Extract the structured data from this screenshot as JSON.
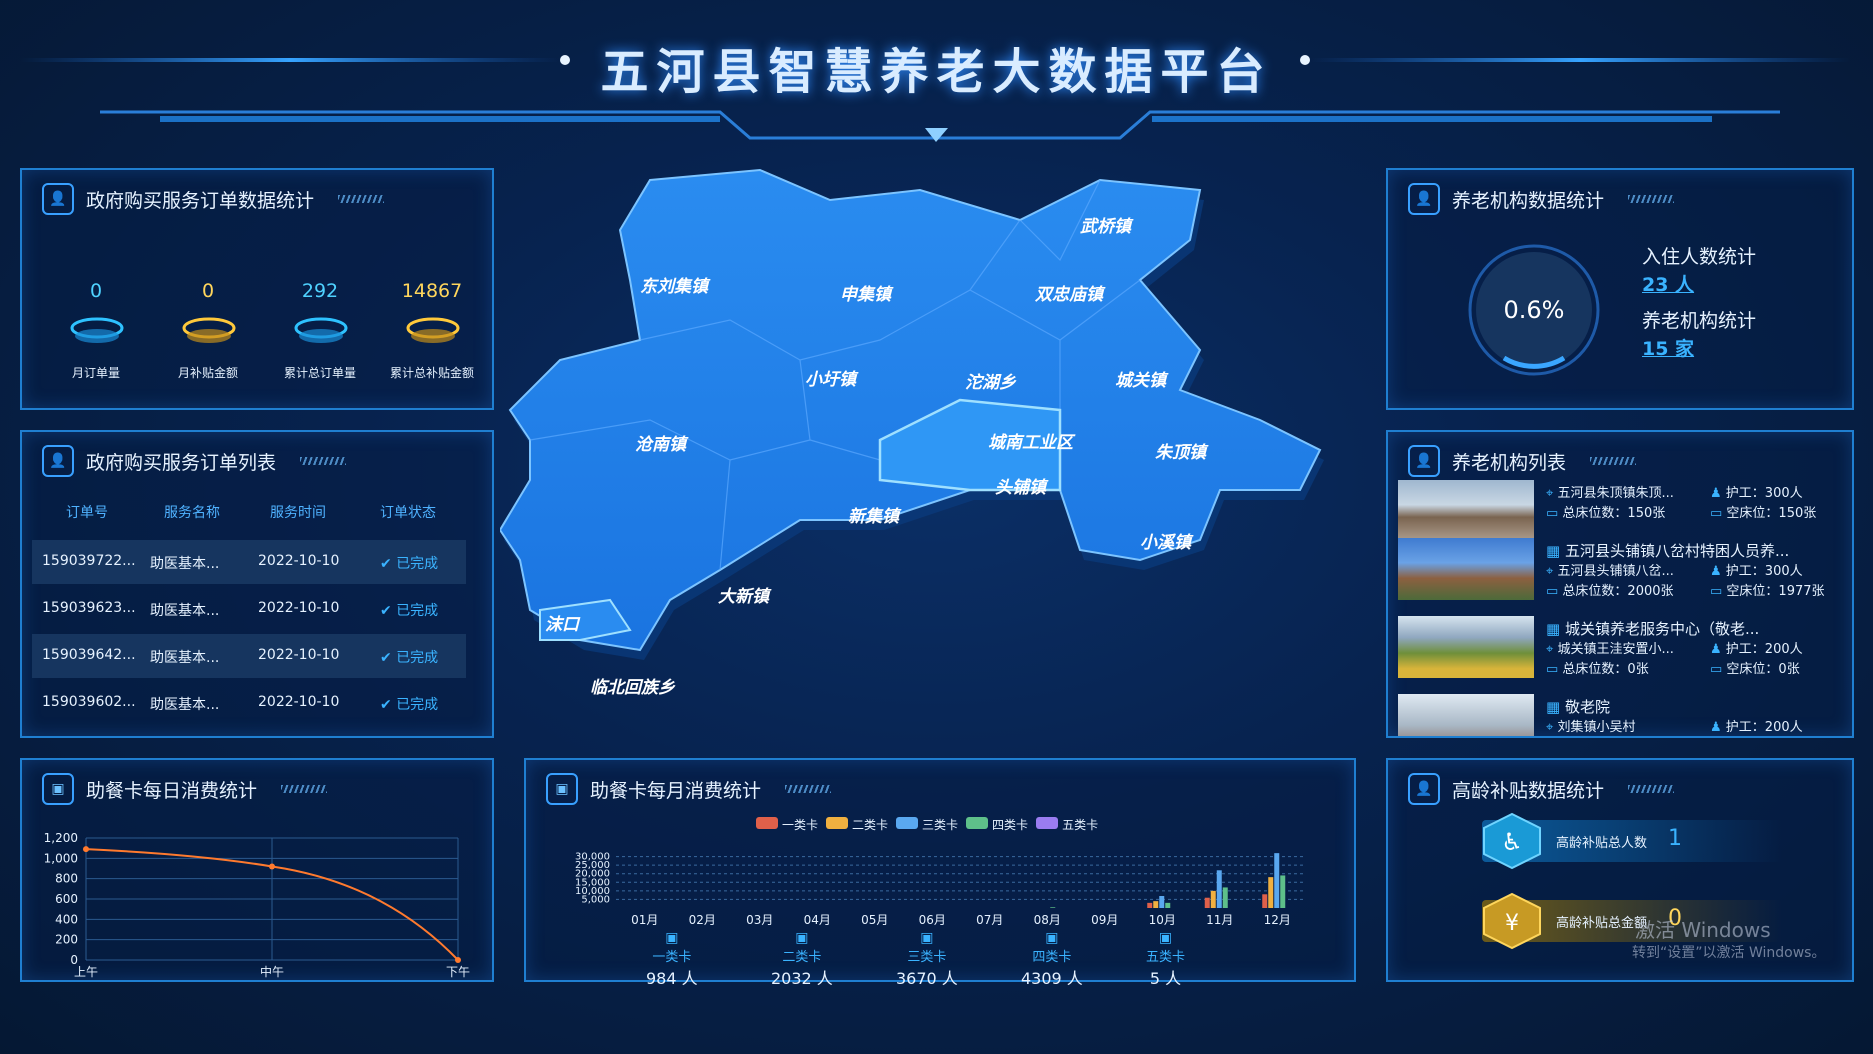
{
  "header": {
    "title": "五河县智慧养老大数据平台"
  },
  "order_stats": {
    "title": "政府购买服务订单数据统计",
    "items": [
      {
        "value": "0",
        "label": "月订单量",
        "color": "#4fd2ff"
      },
      {
        "value": "0",
        "label": "月补贴金额",
        "color": "#ffd65c"
      },
      {
        "value": "292",
        "label": "累计总订单量",
        "color": "#4fd2ff"
      },
      {
        "value": "14867",
        "label": "累计总补贴金额",
        "color": "#ffd65c"
      }
    ]
  },
  "order_list": {
    "title": "政府购买服务订单列表",
    "headers": [
      "订单号",
      "服务名称",
      "服务时间",
      "订单状态"
    ],
    "rows": [
      {
        "id": "159039722...",
        "name": "助医基本...",
        "time": "2022-10-10",
        "status": "已完成"
      },
      {
        "id": "159039623...",
        "name": "助医基本...",
        "time": "2022-10-10",
        "status": "已完成"
      },
      {
        "id": "159039642...",
        "name": "助医基本...",
        "time": "2022-10-10",
        "status": "已完成"
      },
      {
        "id": "159039602...",
        "name": "助医基本...",
        "time": "2022-10-10",
        "status": "已完成"
      }
    ]
  },
  "daily": {
    "title": "助餐卡每日消费统计"
  },
  "map": {
    "regions": [
      "武桥镇",
      "东刘集镇",
      "申集镇",
      "双忠庙镇",
      "小圩镇",
      "沱湖乡",
      "城关镇",
      "沧南镇",
      "城南工业区",
      "朱顶镇",
      "头铺镇",
      "新集镇",
      "小溪镇",
      "大新镇",
      "沫口",
      "临北回族乡"
    ]
  },
  "monthly": {
    "title": "助餐卡每月消费统计",
    "legend": [
      "一类卡",
      "二类卡",
      "三类卡",
      "四类卡",
      "五类卡"
    ],
    "card_colors": [
      "#e0604a",
      "#f0b040",
      "#5aa8f0",
      "#5ec08a",
      "#9a7cf0"
    ],
    "cards": [
      {
        "name": "一类卡",
        "count": "984 人"
      },
      {
        "name": "二类卡",
        "count": "2032 人"
      },
      {
        "name": "三类卡",
        "count": "3670 人"
      },
      {
        "name": "四类卡",
        "count": "4309 人"
      },
      {
        "name": "五类卡",
        "count": "5 人"
      }
    ]
  },
  "institution_stats": {
    "title": "养老机构数据统计",
    "percent": "0.6%",
    "resident_label": "入住人数统计",
    "resident_value": "23 人",
    "inst_label": "养老机构统计",
    "inst_value": "15 家"
  },
  "institution_list": {
    "title": "养老机构列表",
    "items": [
      {
        "name": "五河县朱顶镇朱顶...",
        "nurse": "护工：300人",
        "beds": "总床位数：150张",
        "free": "空床位：150张",
        "addr": ""
      },
      {
        "name": "五河县头铺镇八岔村特困人员养...",
        "addr": "五河县头铺镇八岔...",
        "nurse": "护工：300人",
        "beds": "总床位数：2000张",
        "free": "空床位：1977张"
      },
      {
        "name": "城关镇养老服务中心（敬老...",
        "addr": "城关镇王洼安置小...",
        "nurse": "护工：200人",
        "beds": "总床位数：0张",
        "free": "空床位：0张"
      },
      {
        "name": "敬老院",
        "addr": "刘集镇小吴村",
        "nurse": "护工：200人",
        "beds": "",
        "free": ""
      }
    ]
  },
  "subsidy": {
    "title": "高龄补贴数据统计",
    "count_label": "高龄补贴总人数",
    "count_value": "1",
    "amount_label": "高龄补贴总金额",
    "amount_value": "0"
  },
  "watermark": {
    "line1": "激活 Windows",
    "line2": "转到“设置”以激活 Windows。"
  },
  "chart_data": [
    {
      "type": "line",
      "title": "助餐卡每日消费统计",
      "categories": [
        "上午",
        "中午",
        "下午"
      ],
      "values": [
        1090,
        920,
        0
      ],
      "ylim": [
        0,
        1200
      ],
      "yticks": [
        0,
        200,
        400,
        600,
        800,
        1000,
        1200
      ],
      "ytick_labels": [
        "0",
        "200",
        "400",
        "600",
        "800",
        "1,000",
        "1,200"
      ],
      "grid": true
    },
    {
      "type": "bar",
      "title": "助餐卡每月消费统计",
      "categories": [
        "01月",
        "02月",
        "03月",
        "04月",
        "05月",
        "06月",
        "07月",
        "08月",
        "09月",
        "10月",
        "11月",
        "12月"
      ],
      "yticks": [
        5000,
        10000,
        15000,
        20000,
        25000,
        30000
      ],
      "ytick_labels": [
        "5,000",
        "10,000",
        "15,000",
        "20,000",
        "25,000",
        "30,000"
      ],
      "ylim": [
        0,
        35000
      ],
      "legend_position": "top",
      "series": [
        {
          "name": "一类卡",
          "values": [
            0,
            0,
            0,
            0,
            0,
            0,
            0,
            0,
            0,
            3000,
            6000,
            8000
          ]
        },
        {
          "name": "二类卡",
          "values": [
            0,
            0,
            0,
            0,
            0,
            0,
            0,
            0,
            0,
            4000,
            10000,
            18000
          ]
        },
        {
          "name": "三类卡",
          "values": [
            0,
            0,
            0,
            0,
            0,
            0,
            0,
            0,
            0,
            7000,
            22000,
            32000
          ]
        },
        {
          "name": "四类卡",
          "values": [
            0,
            0,
            0,
            0,
            0,
            0,
            0,
            400,
            0,
            3000,
            12000,
            19000
          ]
        },
        {
          "name": "五类卡",
          "values": [
            0,
            0,
            0,
            0,
            0,
            0,
            0,
            0,
            0,
            0,
            0,
            0
          ]
        }
      ]
    }
  ]
}
